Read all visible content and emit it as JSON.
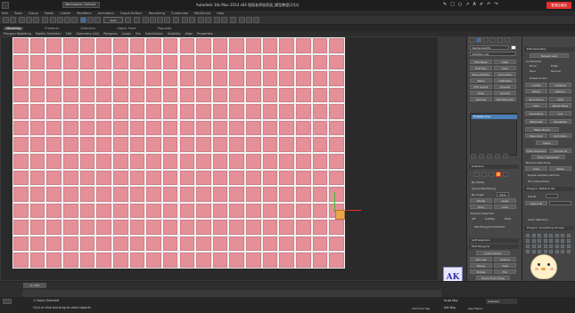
{
  "titlebar": {
    "title": "Autodesk 3ds Max 2014 x64     饭饭老师鼠家居_模型教程(2)[a]",
    "workspace": "Workspace: Default",
    "red_button": "登录后添加"
  },
  "menubar": [
    "Edit",
    "Tools",
    "Group",
    "Views",
    "Create",
    "Modifiers",
    "Animation",
    "Graph Editors",
    "Rendering",
    "Customize",
    "MAXScript",
    "Help"
  ],
  "toolbar": {
    "view_dropdown": "View"
  },
  "ribbon": {
    "tabs": [
      "Modeling",
      "Freeform",
      "Selection",
      "Object Paint",
      "Populate"
    ],
    "active": "Modeling",
    "subtabs": [
      "Polygon Modeling",
      "Modify Selection",
      "Edit",
      "Geometry (All)",
      "Polygons",
      "Loops",
      "Tris",
      "Subdivision",
      "Visibility",
      "Align",
      "Properties"
    ]
  },
  "command_panel": {
    "object_name": "Rectangle001",
    "modifier_list": "Modifier List",
    "buttons": [
      [
        "Edit Mesh",
        "Shell"
      ],
      [
        "Edit Poly",
        "Slice"
      ],
      [
        "Bevel Profile",
        "Symmetry"
      ],
      [
        "Bend",
        "UVW Map"
      ],
      [
        "FFD 2x2x2",
        "Smooth"
      ],
      [
        "Push",
        "Smooth"
      ],
      [
        "Normal",
        "MeshSmooth"
      ]
    ],
    "stack_item": "Editable Poly",
    "selection_header": "Selection",
    "by_vertex": "By Vertex",
    "ignore_backfacing": "Ignore Backfacing",
    "by_angle": "By Angle:",
    "angle_value": "45.0",
    "shrink": "Shrink",
    "grow": "Grow",
    "ring": "Ring",
    "loop": "Loop",
    "preview_selection": "Preview Selection",
    "preview_off": "Off",
    "preview_subobj": "SubObj",
    "preview_multi": "Multi",
    "polygons_selected": "992 Polygons Selected",
    "soft_selection": "Soft Selection",
    "edit_polygons": "Edit Polygons",
    "insert_vertex": "Insert Vertex",
    "extrude": "Extrude",
    "outline": "Outline",
    "bevel": "Bevel",
    "inset": "Inset",
    "bridge": "Bridge",
    "flip": "Flip",
    "hinge": "Hinge From Edge",
    "extrude_spline": "Extrude Along Spline"
  },
  "panel3": {
    "soft_geometry": "Edit Geometry",
    "repeat_last": "Repeat Last",
    "constraints": "Constraints",
    "none": "None",
    "edge": "Edge",
    "face": "Face",
    "normal": "Normal",
    "preserve_uvs": "Preserve UVs",
    "create": "Create",
    "collapse": "Collapse",
    "attach": "Attach",
    "detach": "Detach",
    "slice_plane": "Slice Plane",
    "split": "Split",
    "slice": "Slice",
    "reset_plane": "Reset Plane",
    "quickslice": "QuickSlice",
    "cut": "Cut",
    "msmooth": "MSmooth",
    "tessellate": "Tessellate",
    "make_planar": "Make Planar",
    "view_align": "View Align",
    "grid_align": "Grid Align",
    "relax": "Relax",
    "hide_selected": "Hide Selected",
    "unhide_all": "Unhide All",
    "hide_unselected": "Hide Unselected",
    "named_selections": "Named Selections:",
    "copy": "Copy",
    "paste": "Paste",
    "delete_isolated": "Delete Isolated Vertices",
    "full_interactivity": "Full Interactivity",
    "polygon_material_ids": "Polygon: Material IDs",
    "set_id": "Set ID:",
    "select_id": "Select ID",
    "clear_selection": "Clear Selection",
    "smoothing_groups": "Polygon: Smoothing Groups",
    "xy": "XY",
    "xy_value": "1"
  },
  "timeline": {
    "frame": "0 / 100"
  },
  "status": {
    "line1": "1 Object Selected",
    "line2": "Click or click-and-drag to select objects",
    "auto_key": "Auto Key",
    "selected": "Selected",
    "set_key": "Set Key",
    "key_filters": "Key Filters...",
    "add_time_tag": "Add Time Tag"
  },
  "logo": {
    "text": "AK"
  }
}
